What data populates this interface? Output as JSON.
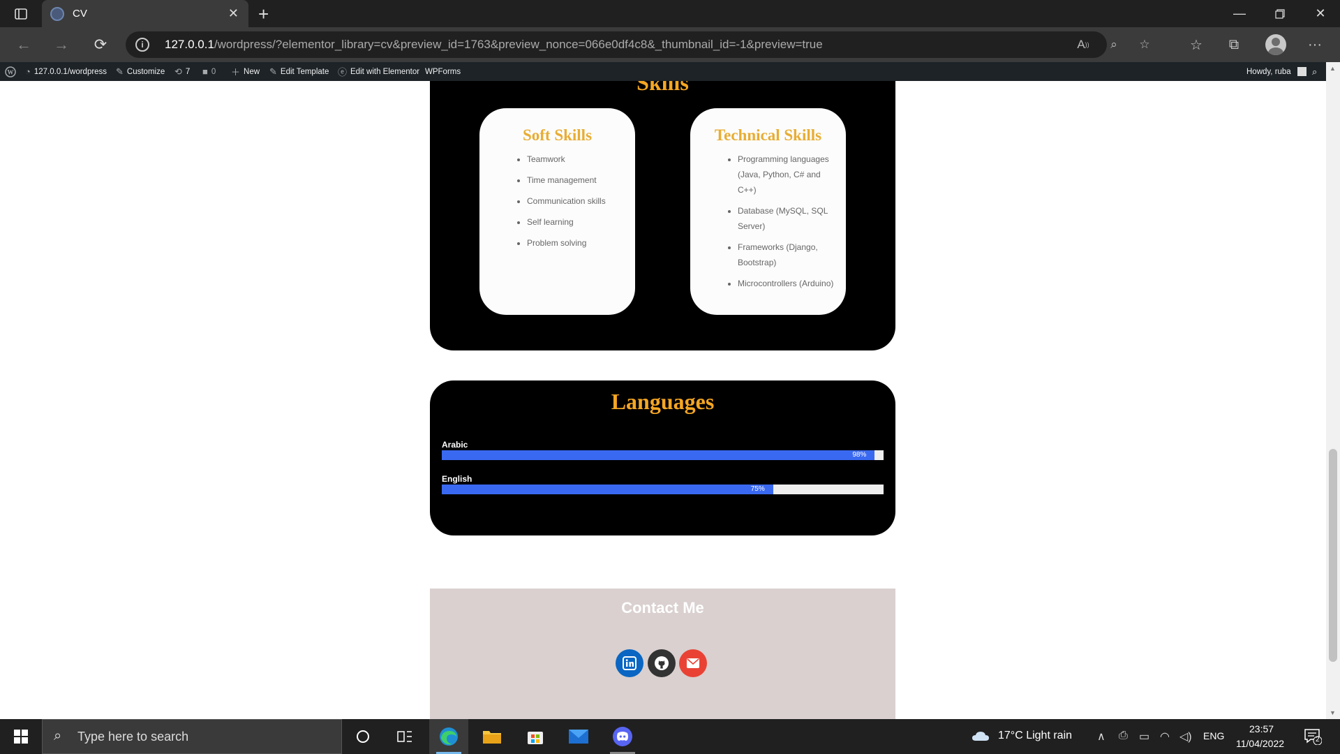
{
  "browser": {
    "tab_title": "CV",
    "url_host": "127.0.0.1",
    "url_rest": "/wordpress/?elementor_library=cv&preview_id=1763&preview_nonce=066e0df4c8&_thumbnail_id=-1&preview=true"
  },
  "wpbar": {
    "site": "127.0.0.1/wordpress",
    "customize": "Customize",
    "updates": "7",
    "comments": "0",
    "new": "New",
    "edit_template": "Edit Template",
    "edit_elementor": "Edit with Elementor",
    "wpforms": "WPForms",
    "howdy": "Howdy, ruba"
  },
  "skills": {
    "heading": "Skills",
    "soft": {
      "title": "Soft Skills",
      "items": [
        "Teamwork",
        "Time management",
        "Communication skills",
        "Self learning",
        "Problem solving"
      ]
    },
    "technical": {
      "title": "Technical Skills",
      "items": [
        "Programming languages (Java, Python, C# and C++)",
        "Database (MySQL, SQL Server)",
        "Frameworks (Django, Bootstrap)",
        "Microcontrollers (Arduino)"
      ]
    }
  },
  "languages": {
    "heading": "Languages",
    "items": [
      {
        "name": "Arabic",
        "percent": 98,
        "label": "98%"
      },
      {
        "name": "English",
        "percent": 75,
        "label": "75%"
      }
    ]
  },
  "contact": {
    "heading": "Contact Me",
    "icons": [
      "linkedin-icon",
      "github-icon",
      "email-icon"
    ]
  },
  "colors": {
    "accent": "#f5a623",
    "bar": "#3a69f1",
    "contact_bg": "#d9d0cf"
  },
  "taskbar": {
    "search_placeholder": "Type here to search",
    "weather": "17°C  Light rain",
    "lang": "ENG",
    "time": "23:57",
    "date": "11/04/2022",
    "notifications": "2"
  }
}
